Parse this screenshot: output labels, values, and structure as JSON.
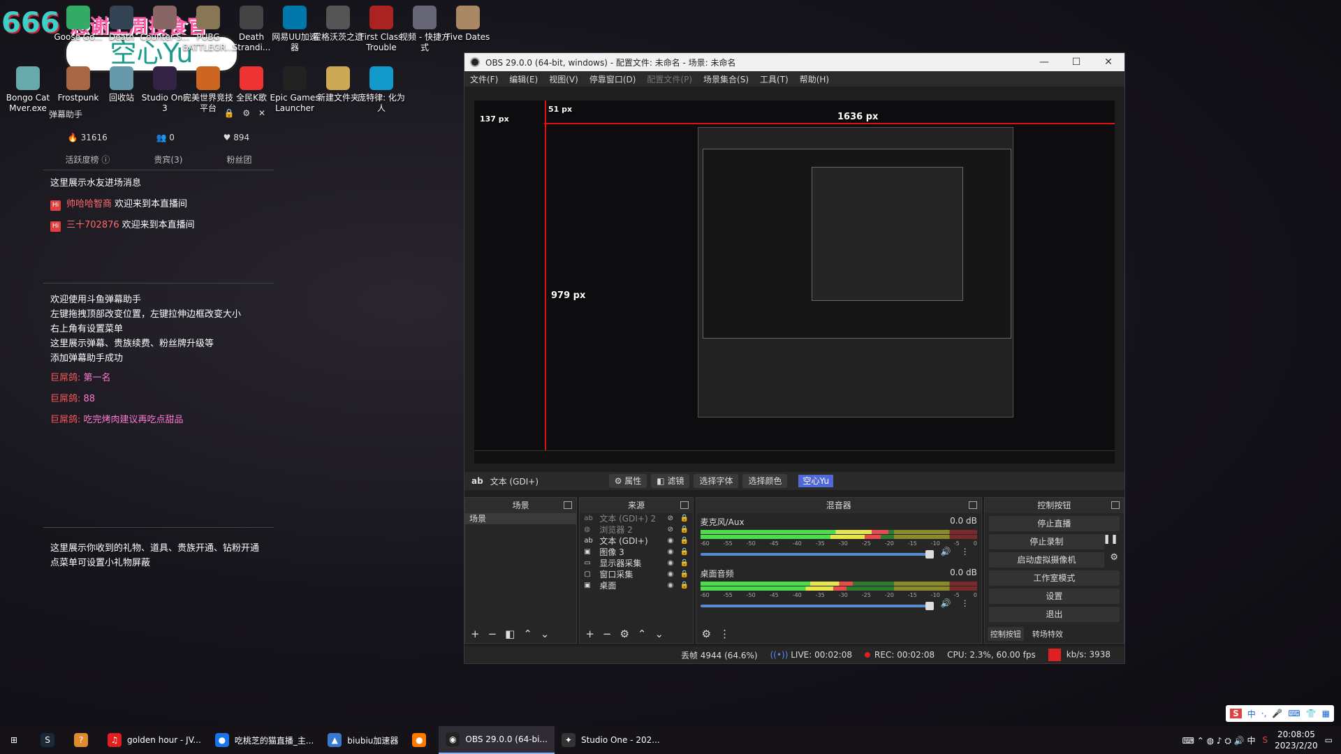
{
  "desktop_icons": [
    {
      "label": "Goose Go...",
      "x": 0,
      "y": 8
    },
    {
      "label": "Death",
      "x": 0,
      "y": 8
    },
    {
      "label": "Counter-S...",
      "x": 0,
      "y": 8
    },
    {
      "label": "PUBG BATTLEGR...",
      "x": 0,
      "y": 8
    },
    {
      "label": "Death Strandi...",
      "x": 0,
      "y": 8
    },
    {
      "label": "网易UU加速器",
      "x": 0,
      "y": 8
    },
    {
      "label": "霍格沃茨之遗",
      "x": 0,
      "y": 8
    },
    {
      "label": "First Class Trouble",
      "x": 0,
      "y": 8
    },
    {
      "label": "视频 - 快捷方式",
      "x": 0,
      "y": 8
    },
    {
      "label": "Five Dates",
      "x": 0,
      "y": 8
    },
    {
      "label": "Bongo Cat Mver.exe",
      "x": 0,
      "y": 95
    },
    {
      "label": "Frostpunk",
      "x": 0,
      "y": 95
    },
    {
      "label": "回收站",
      "x": 0,
      "y": 95
    },
    {
      "label": "Studio One 3",
      "x": 0,
      "y": 95
    },
    {
      "label": "完美世界竞技平台",
      "x": 0,
      "y": 95
    },
    {
      "label": "全民K歌",
      "x": 0,
      "y": 95
    },
    {
      "label": "Epic Games Launcher",
      "x": 0,
      "y": 95
    },
    {
      "label": "新建文件夹",
      "x": 0,
      "y": 95
    },
    {
      "label": "庞特律: 化为人",
      "x": 0,
      "y": 95
    }
  ],
  "badge": {
    "number": "666",
    "thanks": "感谢上周投食官",
    "name": "空心Yu"
  },
  "danmaku": {
    "title": "弹幕助手",
    "tools": "🔒 ⚙ ✕",
    "stats": [
      {
        "icon": "🔥",
        "value": "31616"
      },
      {
        "icon": "👥",
        "value": "0"
      },
      {
        "icon": "♥",
        "value": "894"
      }
    ],
    "tabs": [
      "活跃度榜 ⓘ",
      "贵宾(3)",
      "粉丝团"
    ],
    "enter_header": "这里展示水友进场消息",
    "enters": [
      {
        "badge": "Hi",
        "nick": "帅哈哈智商",
        "text": "欢迎来到本直播间"
      },
      {
        "badge": "Hi",
        "nick": "三十702876",
        "text": "欢迎来到本直播间"
      }
    ],
    "welcome_lines": [
      "欢迎使用斗鱼弹幕助手",
      "左键拖拽顶部改变位置，左键拉伸边框改变大小",
      "右上角有设置菜单",
      "这里展示弹幕、贵族续费、粉丝牌升级等",
      "添加弹幕助手成功"
    ],
    "chat": [
      {
        "user": "巨屌鸽:",
        "text": "第一名"
      },
      {
        "user": "巨屌鸽:",
        "text": "88"
      },
      {
        "user": "巨屌鸽:",
        "text": "吃完烤肉建议再吃点甜品"
      }
    ],
    "gift_lines": [
      "这里展示你收到的礼物、道具、贵族开通、钻粉开通",
      "点菜单可设置小礼物屏蔽"
    ]
  },
  "obs": {
    "title": "OBS 29.0.0 (64-bit, windows) - 配置文件: 未命名 - 场景: 未命名",
    "window_buttons": [
      "—",
      "☐",
      "✕"
    ],
    "menu": [
      {
        "label": "文件(F)",
        "disabled": false
      },
      {
        "label": "编辑(E)",
        "disabled": false
      },
      {
        "label": "视图(V)",
        "disabled": false
      },
      {
        "label": "停靠窗口(D)",
        "disabled": false
      },
      {
        "label": "配置文件(P)",
        "disabled": true
      },
      {
        "label": "场景集合(S)",
        "disabled": false
      },
      {
        "label": "工具(T)",
        "disabled": false
      },
      {
        "label": "帮助(H)",
        "disabled": false
      }
    ],
    "preview_labels": {
      "width": "1636 px",
      "height": "979 px",
      "top": "137 px",
      "left": "51 px"
    },
    "source_toolbar": {
      "source_type": "文本 (GDI+)",
      "properties": "属性",
      "filters": "滤镜",
      "select_font": "选择字体",
      "select_color": "选择颜色",
      "text_value": "空心Yu"
    },
    "docks": {
      "scenes": {
        "title": "场景",
        "items": [
          "场景"
        ]
      },
      "sources": {
        "title": "来源",
        "items": [
          {
            "icon": "ab",
            "name": "文本 (GDI+) 2",
            "dim": true
          },
          {
            "icon": "◍",
            "name": "浏览器 2",
            "dim": true
          },
          {
            "icon": "ab",
            "name": "文本 (GDI+)",
            "dim": false
          },
          {
            "icon": "▣",
            "name": "图像 3",
            "dim": false
          },
          {
            "icon": "▭",
            "name": "显示器采集",
            "dim": false
          },
          {
            "icon": "▢",
            "name": "窗口采集",
            "dim": false
          },
          {
            "icon": "▣",
            "name": "桌面",
            "dim": false
          }
        ]
      },
      "mixer": {
        "title": "混音器",
        "channels": [
          {
            "name": "麦克风/Aux",
            "db": "0.0 dB",
            "level": 0.68
          },
          {
            "name": "桌面音频",
            "db": "0.0 dB",
            "level": 0.55
          }
        ],
        "scale": [
          "-60",
          "-55",
          "-50",
          "-45",
          "-40",
          "-35",
          "-30",
          "-25",
          "-20",
          "-15",
          "-10",
          "-5",
          "0"
        ]
      },
      "controls": {
        "title": "控制按钮",
        "buttons": [
          "停止直播",
          "停止录制",
          "启动虚拟摄像机",
          "工作室模式",
          "设置",
          "退出"
        ],
        "tabs": [
          "控制按钮",
          "转场特效"
        ]
      }
    },
    "status": {
      "dropped": "丢帧 4944 (64.6%)",
      "live": "LIVE: 00:02:08",
      "rec": "REC: 00:02:08",
      "cpu": "CPU: 2.3%, 60.00 fps",
      "kbs": "kb/s: 3938"
    }
  },
  "taskbar": {
    "items": [
      {
        "label": "",
        "icon": "⊞",
        "color": "#151318"
      },
      {
        "label": "",
        "icon": "S",
        "color": "#1b2838"
      },
      {
        "label": "",
        "icon": "?",
        "color": "#e08a30"
      },
      {
        "label": "golden hour - JV...",
        "icon": "♫",
        "color": "#e02020"
      },
      {
        "label": "吃桃芝的猫直播_主...",
        "icon": "●",
        "color": "#1a73e8"
      },
      {
        "label": "biubiu加速器",
        "icon": "▲",
        "color": "#3a78d0"
      },
      {
        "label": "",
        "icon": "●",
        "color": "#ff7a00"
      },
      {
        "label": "OBS 29.0.0 (64-bi...",
        "icon": "◉",
        "color": "#222"
      },
      {
        "label": "Studio One - 202...",
        "icon": "✦",
        "color": "#333"
      }
    ],
    "time": "20:08:05",
    "date": "2023/2/20",
    "ime": [
      "S",
      "中",
      "·,",
      "🎤",
      "⌨",
      "👕",
      "▦"
    ]
  }
}
